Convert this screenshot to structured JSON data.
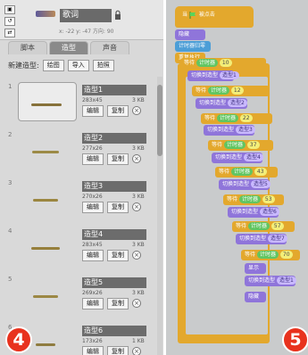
{
  "badges": {
    "left": "4",
    "right": "5"
  },
  "panel4": {
    "sprite_name": "歌词",
    "coords": "x: -22   y: -47   方向: 90",
    "tabs": [
      "脚本",
      "造型",
      "声音"
    ],
    "active_tab": "造型",
    "new_label": "新建造型:",
    "new_buttons": [
      "绘图",
      "导入",
      "拍照"
    ],
    "costumes": [
      {
        "index": "1",
        "name": "造型1",
        "size": "283x45",
        "kb": "3 KB",
        "edit": "编辑",
        "copy": "复制",
        "selected": true
      },
      {
        "index": "2",
        "name": "造型2",
        "size": "277x26",
        "kb": "3 KB",
        "edit": "编辑",
        "copy": "复制",
        "selected": false
      },
      {
        "index": "3",
        "name": "造型3",
        "size": "270x26",
        "kb": "3 KB",
        "edit": "编辑",
        "copy": "复制",
        "selected": false
      },
      {
        "index": "4",
        "name": "造型4",
        "size": "283x45",
        "kb": "3 KB",
        "edit": "编辑",
        "copy": "复制",
        "selected": false
      },
      {
        "index": "5",
        "name": "造型5",
        "size": "269x26",
        "kb": "3 KB",
        "edit": "编辑",
        "copy": "复制",
        "selected": false
      },
      {
        "index": "6",
        "name": "造型6",
        "size": "173x26",
        "kb": "1 KB",
        "edit": "编辑",
        "copy": "复制",
        "selected": false
      }
    ]
  },
  "panel5": {
    "hat": {
      "prefix": "当",
      "suffix": "被点击"
    },
    "hide": "隐藏",
    "timer_reset": "计时器归零",
    "repeat_forever": "重复执行",
    "wait_until": "等待",
    "timer": "计时器",
    "switch_costume": "切换到造型",
    "show": "显示",
    "next_costume": "造型1"
  }
}
